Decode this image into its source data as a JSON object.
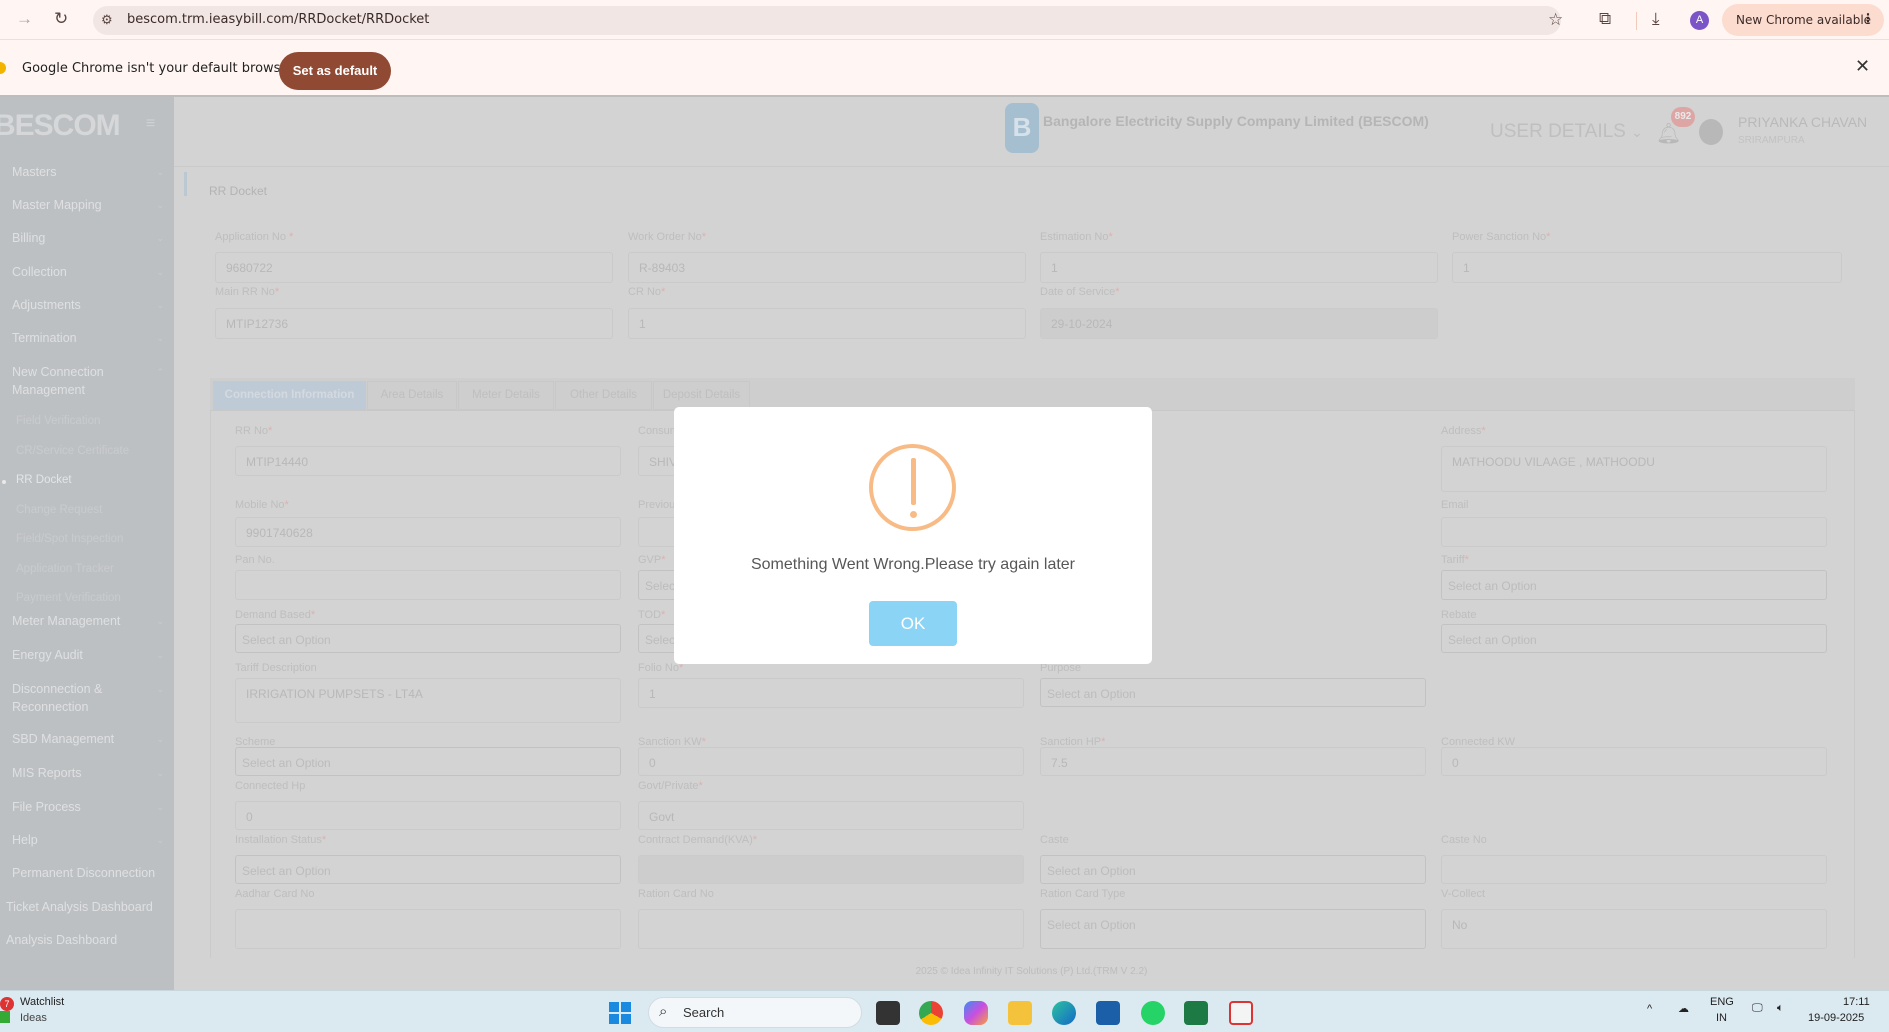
{
  "browser": {
    "url": "bescom.trm.ieasybill.com/RRDocket/RRDocket",
    "new_chrome": "New Chrome available",
    "profile_initial": "A",
    "infobar_text": "Google Chrome isn't your default browser",
    "set_default": "Set as default"
  },
  "sidebar": {
    "brand": "BESCOM",
    "items": [
      {
        "label": "Masters"
      },
      {
        "label": "Master Mapping"
      },
      {
        "label": "Billing"
      },
      {
        "label": "Collection"
      },
      {
        "label": "Adjustments"
      },
      {
        "label": "Termination"
      },
      {
        "label": "New Connection Management"
      }
    ],
    "subitems": [
      "Field Verification",
      "CR/Service Certificate",
      "RR Docket",
      "Change Request",
      "Field/Spot Inspection",
      "Application Tracker",
      "Payment Verification"
    ],
    "items2": [
      {
        "label": "Meter Management"
      },
      {
        "label": "Energy Audit"
      },
      {
        "label": "Disconnection & Reconnection"
      },
      {
        "label": "SBD Management"
      },
      {
        "label": "MIS Reports"
      },
      {
        "label": "File Process"
      },
      {
        "label": "Help"
      },
      {
        "label": "Permanent Disconnection"
      },
      {
        "label": "Ticket Analysis Dashboard"
      },
      {
        "label": "Analysis Dashboard"
      }
    ]
  },
  "header": {
    "org": "Bangalore Electricity Supply Company Limited (BESCOM)",
    "user_details": "USER DETAILS",
    "notif_count": "892",
    "user_name": "PRIYANKA CHAVAN",
    "user_location": "SRIRAMPURA"
  },
  "page": {
    "title": "RR Docket"
  },
  "top_fields": [
    {
      "label": "Application No ",
      "req": "*",
      "value": "9680722"
    },
    {
      "label": "Work Order No",
      "req": "*",
      "value": "R-89403"
    },
    {
      "label": "Estimation No",
      "req": "*",
      "value": "1"
    },
    {
      "label": "Power Sanction No",
      "req": "*",
      "value": "1"
    },
    {
      "label": "Main RR No",
      "req": "*",
      "value": "MTIP12736"
    },
    {
      "label": "CR No",
      "req": "*",
      "value": "1"
    },
    {
      "label": "Date of Service",
      "req": "*",
      "value": "29-10-2024"
    }
  ],
  "tabs": [
    "Connection Information",
    "Area Details",
    "Meter Details",
    "Other Details",
    "Deposit Details"
  ],
  "fields": [
    {
      "label": "RR No",
      "req": "*",
      "value": "MTIP14440"
    },
    {
      "label": "Mobile No",
      "req": "*",
      "value": "9901740628"
    },
    {
      "label": "Pan No.",
      "req": "",
      "value": ""
    },
    {
      "label": "Demand Based",
      "req": "*",
      "value": "Select an Option"
    },
    {
      "label": "Tariff Description",
      "req": "",
      "value": "IRRIGATION PUMPSETS - LT4A"
    },
    {
      "label": "Scheme",
      "req": "",
      "value": "Select an Option"
    },
    {
      "label": "Connected Hp",
      "req": "",
      "value": "0"
    },
    {
      "label": "Installation Status",
      "req": "*",
      "value": "Select an Option"
    },
    {
      "label": "Aadhar Card No",
      "req": "",
      "value": ""
    },
    {
      "label": "Consum",
      "req": "",
      "value": "SHIV"
    },
    {
      "label": "Previou",
      "req": "",
      "value": ""
    },
    {
      "label": "GVP",
      "req": "*",
      "value": "Select an Option"
    },
    {
      "label": "TOD",
      "req": "*",
      "value": "Select an Option"
    },
    {
      "label": "Folio No",
      "req": "*",
      "value": "1"
    },
    {
      "label": "Sanction KW",
      "req": "*",
      "value": "0"
    },
    {
      "label": "Govt/Private",
      "req": "*",
      "value": "Govt"
    },
    {
      "label": "Contract Demand(KVA)",
      "req": "*",
      "value": ""
    },
    {
      "label": "Ration Card No",
      "req": "",
      "value": ""
    },
    {
      "label": "Purpose",
      "req": "",
      "value": "Select an Option"
    },
    {
      "label": "Sanction HP",
      "req": "*",
      "value": "7.5"
    },
    {
      "label": "Caste",
      "req": "",
      "value": "Select an Option"
    },
    {
      "label": "Ration Card Type",
      "req": "",
      "value": "Select an Option"
    },
    {
      "label": "Address",
      "req": "*",
      "value": "MATHOODU VILAAGE , MATHOODU"
    },
    {
      "label": "Email",
      "req": "",
      "value": ""
    },
    {
      "label": "Tariff",
      "req": "*",
      "value": "Select an Option"
    },
    {
      "label": "Rebate",
      "req": "",
      "value": "Select an Option"
    },
    {
      "label": "Connected KW",
      "req": "",
      "value": "0"
    },
    {
      "label": "Caste No",
      "req": "",
      "value": ""
    },
    {
      "label": "V-Collect",
      "req": "",
      "value": "No"
    }
  ],
  "footer": "2025 © Idea Infinity IT Solutions (P) Ltd.(TRM V 2.2)",
  "modal": {
    "message": "Something Went Wrong.Please try again later",
    "ok": "OK",
    "icon_color": "#f8bb86",
    "button_color": "#8cd4f5"
  },
  "taskbar": {
    "badge": "7",
    "widget_title": "Watchlist",
    "widget_sub": "Ideas",
    "search": "Search",
    "lang1": "ENG",
    "lang2": "IN",
    "time": "17:11",
    "date": "19-09-2025"
  }
}
